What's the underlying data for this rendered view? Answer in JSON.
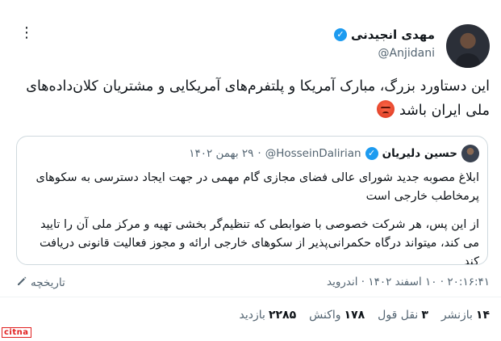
{
  "author": {
    "name": "مهدی انجیدنی",
    "handle": "@Anjidani",
    "verified_glyph": "✓"
  },
  "more_glyph": "⋮",
  "tweet": {
    "text": "این دستاورد بزرگ، مبارک آمریکا و پلتفرم‌های آمریکایی و مشتریان کلان‌داده‌های ملی ایران باشد"
  },
  "quote": {
    "name": "حسین دلیریان",
    "handle": "@HosseinDalirian",
    "separator": "·",
    "date": "۲۹ بهمن ۱۴۰۲",
    "paragraph1": "ابلاغ مصوبه جدید شورای عالی فضای مجازی گام مهمی در جهت ایجاد دسترسی به سکوهای پرمخاطب خارجی است",
    "paragraph2": "از این پس، هر شرکت خصوصی با ضوابطی که تنظیم‌گر بخشی تهیه و مرکز ملی آن را تایید می کند، میتواند درگاه حکمرانی‌پذیر از سکوهای خارجی ارائه و مجوز فعالیت قانونی دریافت کند"
  },
  "meta": {
    "timestamp": "۲۰:۱۶:۴۱ · ۱۰ اسفند ۱۴۰۲ · اندروید",
    "history_label": "تاریخچه"
  },
  "stats": {
    "reposts_count": "۱۴",
    "reposts_label": "بازنشر",
    "quotes_count": "۳",
    "quotes_label": "نقل قول",
    "reactions_count": "۱۷۸",
    "reactions_label": "واکنش",
    "views_count": "۲۲۸۵",
    "views_label": "بازدید"
  },
  "watermark": "citna"
}
